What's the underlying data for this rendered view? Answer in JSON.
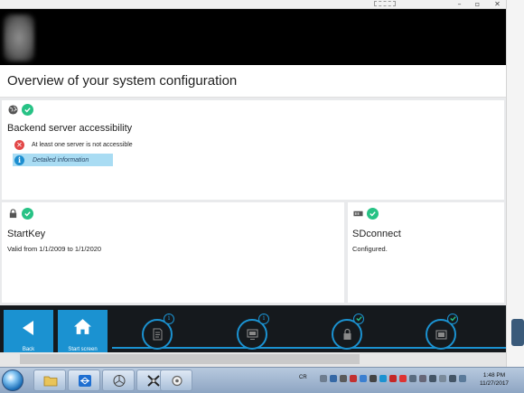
{
  "window": {
    "minimize_glyph": "–",
    "restore_glyph": "▫",
    "close_glyph": "✕"
  },
  "header": {
    "page_title": "Overview of your system configuration"
  },
  "backend": {
    "icon": "globe-icon",
    "status": "ok",
    "title": "Backend server accessibility",
    "error_icon": "error-x-icon",
    "error_text": "At least one server is not accessible",
    "info_icon": "info-icon",
    "info_text": "Detailed information"
  },
  "startkey": {
    "icon": "lock-icon",
    "status": "ok",
    "title": "StartKey",
    "detail": "Valid from 1/1/2009 to 1/1/2020"
  },
  "sdconnect": {
    "icon": "device-icon",
    "status": "ok",
    "title": "SDconnect",
    "detail": "Configured."
  },
  "dock": {
    "back_label": "Back",
    "start_label": "Start screen",
    "items": [
      {
        "icon": "document-icon",
        "badge": "info"
      },
      {
        "icon": "monitor-icon",
        "badge": "info"
      },
      {
        "icon": "lock-icon",
        "badge": "ok"
      },
      {
        "icon": "device-icon",
        "badge": "ok"
      }
    ],
    "accent": "#1b92d1",
    "dark": "#15191d"
  },
  "taskbar": {
    "language": "CR",
    "time": "1:48 PM",
    "date": "11/27/2017",
    "apps": [
      "folder-icon",
      "teamviewer-icon",
      "mercedes-icon",
      "xentry-icon",
      "settings-icon"
    ]
  },
  "colors": {
    "ok_green": "#27c285",
    "error_red": "#e34848",
    "info_blue": "#1c8ed0",
    "info_bg": "#a9dcf3"
  }
}
